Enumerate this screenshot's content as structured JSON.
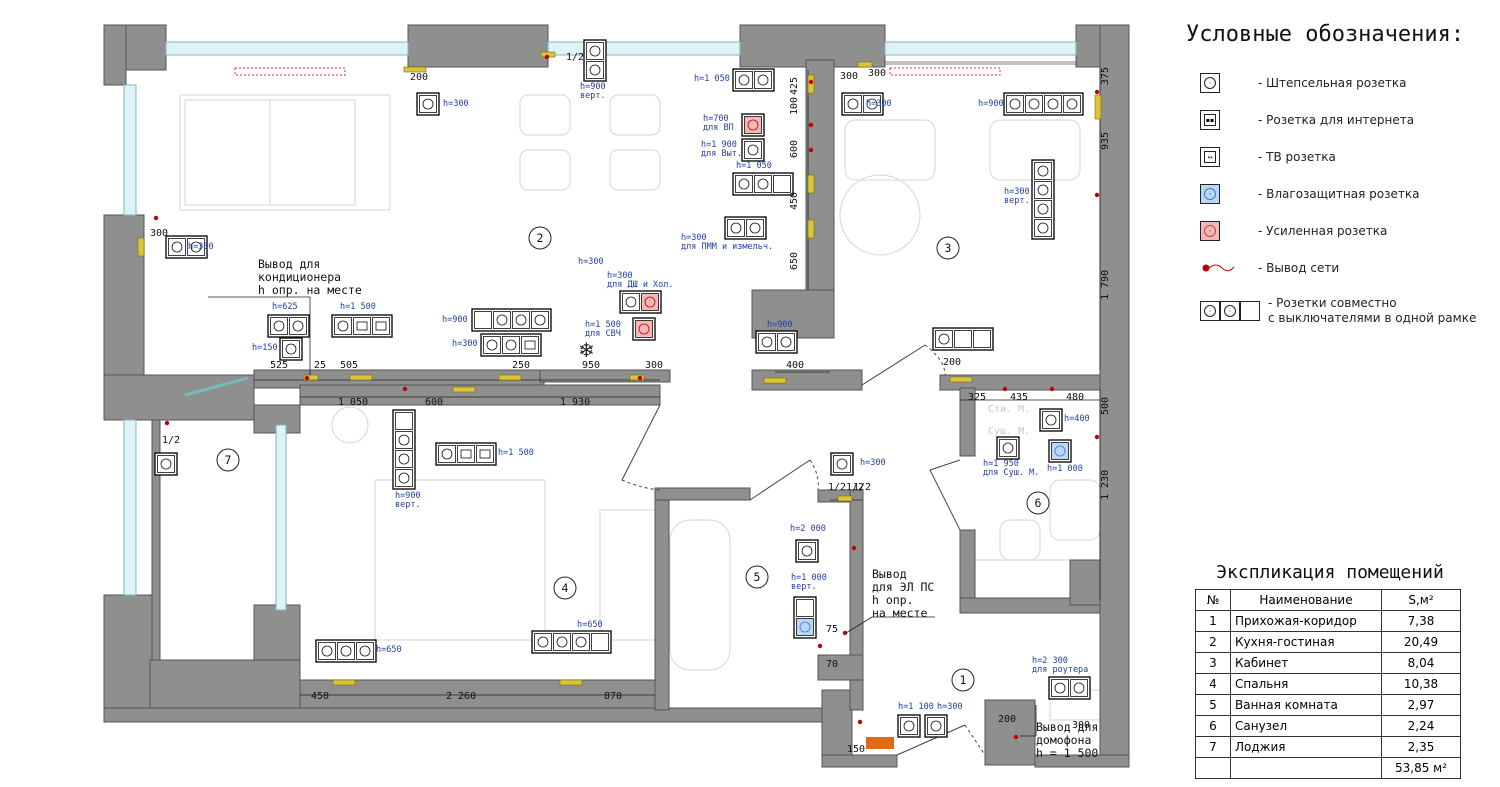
{
  "legend": {
    "title": "Условные обозначения:",
    "items": [
      {
        "icon": "socket-icon",
        "label": "- Штепсельная розетка"
      },
      {
        "icon": "internet-socket-icon",
        "label": "- Розетка для интернета"
      },
      {
        "icon": "tv-socket-icon",
        "label": "- ТВ розетка"
      },
      {
        "icon": "waterproof-socket-icon",
        "label": "- Влагозащитная розетка",
        "color": "#3a7bd5"
      },
      {
        "icon": "reinforced-socket-icon",
        "label": "- Усиленная розетка",
        "color": "#d93a3a"
      },
      {
        "icon": "cable-outlet-icon",
        "label": "- Вывод сети",
        "color": "#c00000"
      },
      {
        "icon": "combo-frame-icon",
        "label": "- Розетки совместно\nс выключателями в одной рамке"
      }
    ]
  },
  "explication": {
    "title": "Экспликация помещений",
    "headers": [
      "№",
      "Наименование",
      "S,м²"
    ],
    "rows": [
      [
        "1",
        "Прихожая-коридор",
        "7,38"
      ],
      [
        "2",
        "Кухня-гостиная",
        "20,49"
      ],
      [
        "3",
        "Кабинет",
        "8,04"
      ],
      [
        "4",
        "Спальня",
        "10,38"
      ],
      [
        "5",
        "Ванная комната",
        "2,97"
      ],
      [
        "6",
        "Санузел",
        "2,24"
      ],
      [
        "7",
        "Лоджия",
        "2,35"
      ]
    ],
    "total": "53,85 м²"
  },
  "plan": {
    "room_numbers": [
      "1",
      "2",
      "3",
      "4",
      "5",
      "6",
      "7"
    ],
    "notes": {
      "ac_outlet": "Вывод для\nкондиционера\nh опр. на месте",
      "heated_floor": "Вывод\nдля ЭЛ ПС\nh опр.\nна месте",
      "intercom": "Вывод для\nдомофона\nh = 1 500"
    },
    "socket_labels": {
      "s1": "h=300",
      "s2": "h=300",
      "s3": "h=1 050",
      "s4": "h=700\nдля ВП",
      "s5": "h=1 900\nдля Выт.",
      "s6": "h=1 050",
      "s7": "h=300\nдля ПММ и измельч.",
      "s8": "h=300\nдля ДШ и Хол.",
      "s9": "h=1 500\nдля СВЧ",
      "s10": "h=900",
      "s11": "h=300",
      "s12": "h=625",
      "s13": "h=150",
      "s14": "h=1 500",
      "s15": "h=300",
      "s16": "h=900",
      "s17": "h=300",
      "s18": "h=900\nверт.",
      "s19": "h=300\nверт.",
      "s20": "h=900",
      "s21": "h=300",
      "s22": "h=900\nверт.",
      "s23": "h=1 500",
      "s24": "h=650",
      "s25": "h=650",
      "s26": "h=2 000",
      "s27": "h=1 000\nверт.",
      "s28": "h=300",
      "s29": "h=400",
      "s30": "h=1 950\nдля Суш. М.",
      "s31": "h=1 000",
      "s32": "h=2 300\nдля роутера",
      "s33": "h=1 100",
      "s34": "h=300",
      "s35": "h=900\nверт."
    },
    "dimensions": [
      "200",
      "1/2",
      "300",
      "375",
      "935",
      "1 790",
      "425",
      "100",
      "600",
      "450",
      "650",
      "300",
      "525",
      "25",
      "505",
      "250",
      "950",
      "300",
      "1 050",
      "600",
      "1 930",
      "400",
      "200",
      "325",
      "435",
      "480",
      "500",
      "1 230",
      "1/2",
      "1/2",
      "1/2",
      "75",
      "70",
      "450",
      "2 260",
      "870",
      "150",
      "200",
      "300",
      "1/2",
      "300"
    ],
    "furniture_labels": [
      "Сти. М.",
      "Суш. М."
    ]
  },
  "colors": {
    "wall": "#8c8c8c",
    "socket_text": "#1f3fa8",
    "marker": "#d4c23a",
    "red": "#c00000",
    "blue": "#3a7bd5"
  }
}
